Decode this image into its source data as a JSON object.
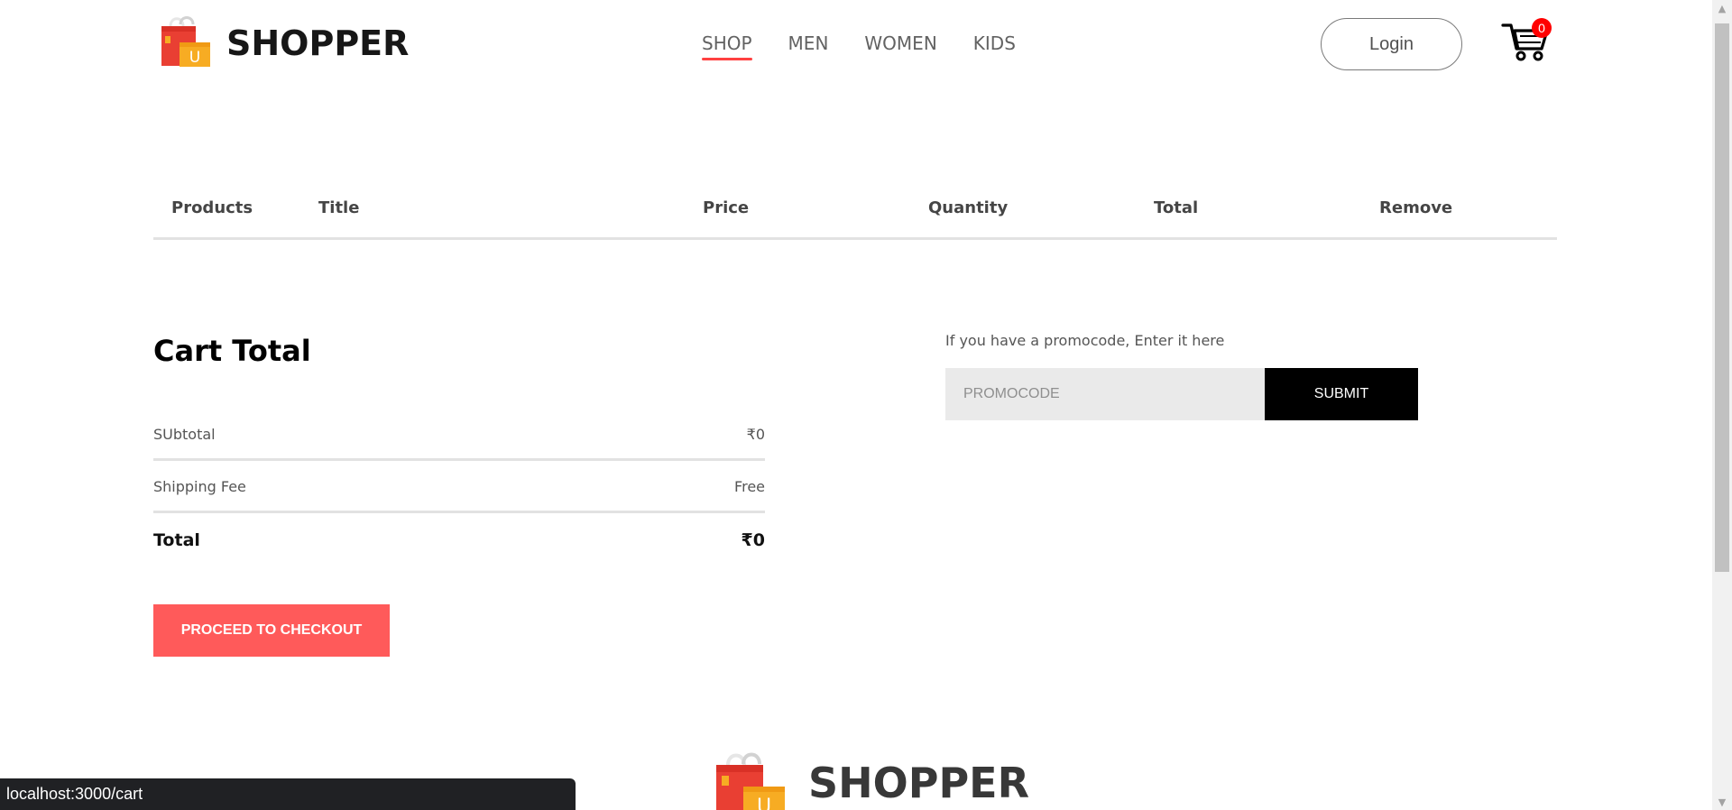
{
  "app": {
    "name": "SHOPPER",
    "status_url": "localhost:3000/cart"
  },
  "navbar": {
    "menu": [
      "SHOP",
      "MEN",
      "WOMEN",
      "KIDS"
    ],
    "active": "SHOP",
    "login_label": "Login",
    "cart_count": "0",
    "accent_color": "#FF4141",
    "logo_icon": "shopping-bag-icon",
    "cart_icon": "cart-icon"
  },
  "cart_table": {
    "headers": [
      "Products",
      "Title",
      "Price",
      "Quantity",
      "Total",
      "Remove"
    ]
  },
  "cart_total": {
    "title": "Cart Total",
    "subtotal_label": "SUbtotal",
    "subtotal_value": "₹0",
    "shipping_label": "Shipping Fee",
    "shipping_value": "Free",
    "total_label": "Total",
    "total_value": "₹0",
    "checkout_label": "PROCEED TO CHECKOUT",
    "checkout_color": "#ff5a5a"
  },
  "promo": {
    "prompt": "If you have a promocode, Enter it here",
    "placeholder": "PROMOCODE",
    "submit_label": "SUBMIT"
  },
  "footer": {
    "brand": "SHOPPER"
  },
  "scrollbar": {
    "up_icon": "up-arrow-icon",
    "down_icon": "down-arrow-icon"
  }
}
